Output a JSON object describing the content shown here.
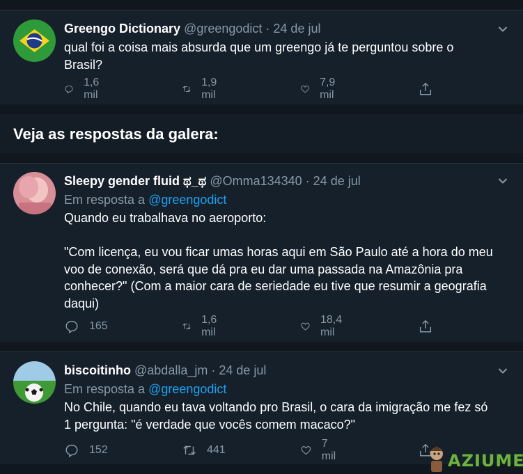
{
  "tweets": [
    {
      "name": "Greengo Dictionary",
      "handle": "@greengodict",
      "dot": " · ",
      "date": "24 de jul",
      "text": "qual foi a coisa mais absurda que um greengo já te perguntou sobre o\nBrasil?",
      "replies": "1,6 mil",
      "retweets": "1,9 mil",
      "likes": "7,9 mil"
    },
    {
      "name": "Sleepy gender fluid ಥ_ಥ",
      "handle": "@Omma134340",
      "dot": " · ",
      "date": "24 de jul",
      "reply_prefix": "Em resposta a ",
      "reply_to": "@greengodict",
      "text": "Quando eu trabalhava no aeroporto:\n\n\"Com licença, eu vou ficar umas horas aqui em São Paulo até a hora do meu\nvoo de conexão, será que dá pra eu dar uma passada na Amazônia pra\nconhecer?\" (Com a maior cara de seriedade eu tive que resumir a geografia\ndaqui)",
      "replies": "165",
      "retweets": "1,6 mil",
      "likes": "18,4 mil"
    },
    {
      "name": "biscoitinho",
      "handle": "@abdalla_jm",
      "dot": " · ",
      "date": "24 de jul",
      "reply_prefix": "Em resposta a ",
      "reply_to": "@greengodict",
      "text": "No Chile, quando eu tava voltando pro Brasil, o cara da imigração me fez só\n1 pergunta: \"é verdade que vocês comem macaco?\"",
      "replies": "152",
      "retweets": "441",
      "likes": "7 mil"
    }
  ],
  "section_title": "Veja as respostas da galera:",
  "watermark": "AZIUME",
  "colors": {
    "background": "#15202b",
    "muted": "#8899a6",
    "link": "#1da1f2",
    "watermark": "#6db43c"
  },
  "icons": [
    "reply-icon",
    "retweet-icon",
    "like-icon",
    "share-icon",
    "chevron-down-icon"
  ]
}
